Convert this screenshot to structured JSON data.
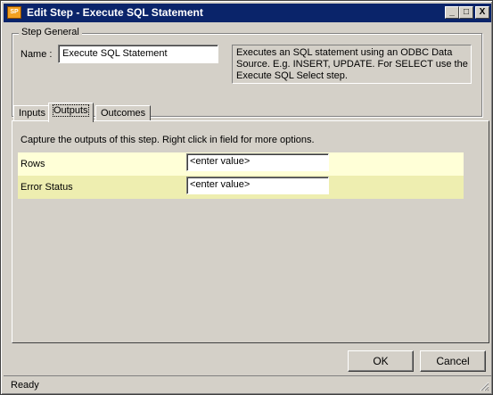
{
  "window": {
    "title": "Edit Step - Execute SQL Statement",
    "icon": "app-icon",
    "icon_text": "SP",
    "controls": {
      "minimize": "_",
      "maximize": "□",
      "close": "X"
    }
  },
  "step_general": {
    "legend": "Step General",
    "name_label": "Name :",
    "name_value": "Execute SQL Statement",
    "description": "Executes an SQL statement using an ODBC Data Source. E.g. INSERT, UPDATE. For SELECT use the Execute SQL Select step."
  },
  "tabs": [
    {
      "label": "Inputs",
      "active": false
    },
    {
      "label": "Outputs",
      "active": true
    },
    {
      "label": "Outcomes",
      "active": false
    }
  ],
  "outputs": {
    "instruction": "Capture the outputs of this step.  Right click in field for more options.",
    "rows": [
      {
        "label": "Rows",
        "value": "<enter value>"
      },
      {
        "label": "Error Status",
        "value": "<enter value>"
      }
    ]
  },
  "buttons": {
    "ok": "OK",
    "cancel": "Cancel"
  },
  "status": {
    "text": "Ready"
  },
  "colors": {
    "title_bar": "#0a246a",
    "row_odd": "#ffffd7",
    "row_even": "#eeeeb0",
    "face": "#d4d0c8"
  }
}
